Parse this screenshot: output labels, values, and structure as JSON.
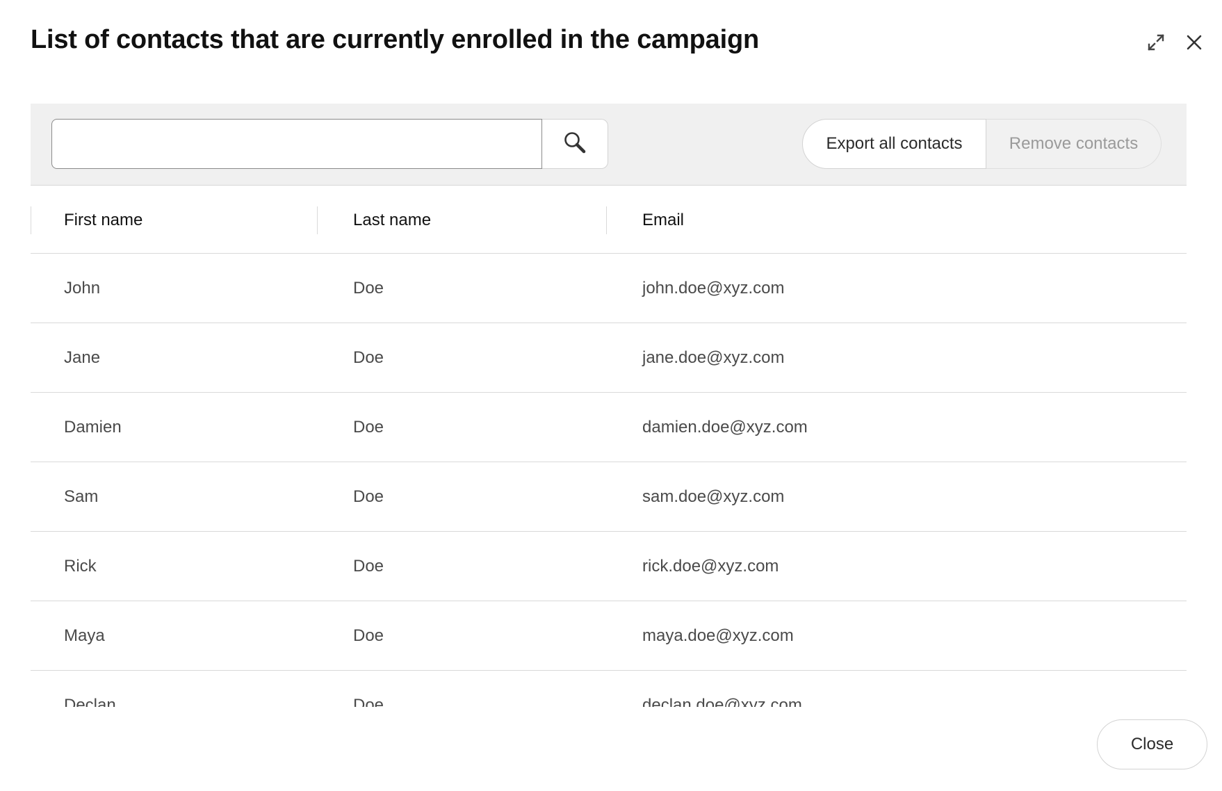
{
  "dialog": {
    "title": "List of contacts that are currently enrolled in the campaign",
    "expand_icon": "expand-icon",
    "close_icon": "close-icon"
  },
  "toolbar": {
    "search": {
      "value": "",
      "placeholder": "",
      "icon": "search-icon"
    },
    "export_label": "Export all contacts",
    "remove_label": "Remove contacts"
  },
  "table": {
    "columns": [
      "First name",
      "Last name",
      "Email"
    ],
    "rows": [
      {
        "first": "John",
        "last": "Doe",
        "email": "john.doe@xyz.com"
      },
      {
        "first": "Jane",
        "last": "Doe",
        "email": "jane.doe@xyz.com"
      },
      {
        "first": "Damien",
        "last": "Doe",
        "email": "damien.doe@xyz.com"
      },
      {
        "first": "Sam",
        "last": "Doe",
        "email": "sam.doe@xyz.com"
      },
      {
        "first": "Rick",
        "last": "Doe",
        "email": "rick.doe@xyz.com"
      },
      {
        "first": "Maya",
        "last": "Doe",
        "email": "maya.doe@xyz.com"
      },
      {
        "first": "Declan",
        "last": "Doe",
        "email": "declan.doe@xyz.com"
      }
    ]
  },
  "footer": {
    "close_label": "Close"
  },
  "colors": {
    "toolbar_bg": "#f0f0f0",
    "disabled_text": "#9a9a9a",
    "divider": "#d9d9d9"
  }
}
